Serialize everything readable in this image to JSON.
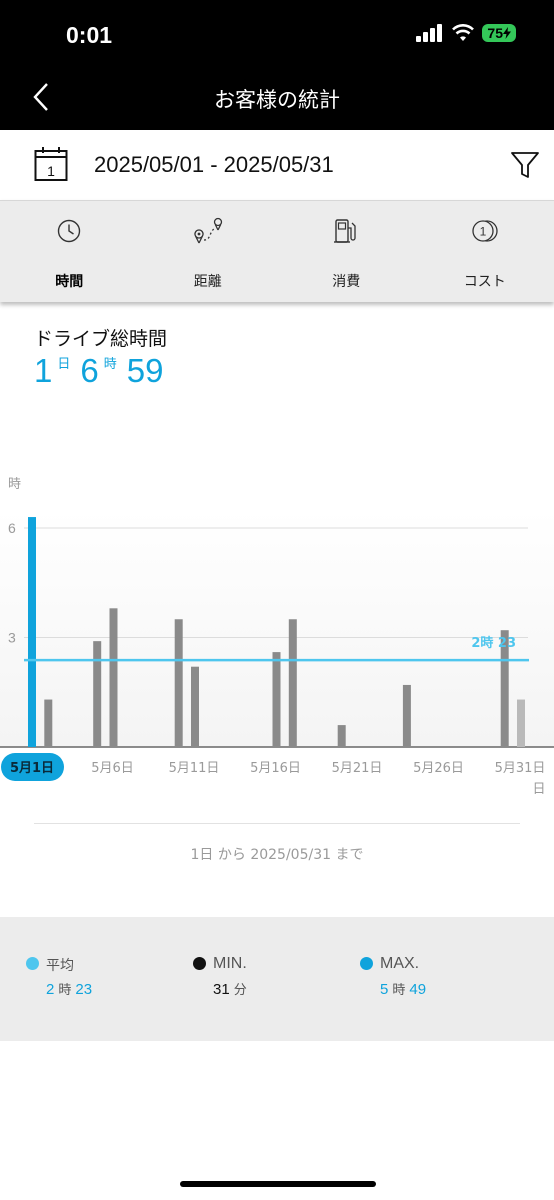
{
  "status_bar": {
    "time": "0:01",
    "battery": "75"
  },
  "header": {
    "title": "お客様の統計"
  },
  "date_filter": {
    "calendar_day": "1",
    "range": "2025/05/01 - 2025/05/31"
  },
  "tabs": [
    {
      "label": "時間",
      "icon": "clock-icon",
      "active": true
    },
    {
      "label": "距離",
      "icon": "route-icon",
      "active": false
    },
    {
      "label": "消費",
      "icon": "fuel-pump-icon",
      "active": false
    },
    {
      "label": "コスト",
      "icon": "coin-icon",
      "active": false
    }
  ],
  "summary": {
    "title": "ドライブ総時間",
    "days": "1",
    "days_unit": "日",
    "hours": "6",
    "hours_unit": "時",
    "minutes": "59"
  },
  "chart_data": {
    "type": "bar",
    "y_unit_label": "時",
    "x_unit_label": "日",
    "ylim": [
      0,
      8
    ],
    "yticks": [
      3,
      6
    ],
    "x": [
      1,
      2,
      3,
      4,
      5,
      6,
      7,
      8,
      9,
      10,
      11,
      12,
      13,
      14,
      15,
      16,
      17,
      18,
      19,
      20,
      21,
      22,
      23,
      24,
      25,
      26,
      27,
      28,
      29,
      30,
      31
    ],
    "values": [
      6.3,
      1.3,
      0,
      0,
      2.9,
      3.8,
      0,
      0,
      0,
      3.5,
      2.2,
      0,
      0,
      0,
      0,
      2.6,
      3.5,
      0,
      0,
      0.6,
      0,
      0,
      0,
      1.7,
      0,
      0,
      0,
      0,
      0,
      3.2,
      1.3
    ],
    "selected_index": 0,
    "pale_indices": [
      30
    ],
    "average": 2.38,
    "average_label": "2時 23",
    "tick_labels": [
      {
        "day": 1,
        "label": "5月1日"
      },
      {
        "day": 6,
        "label": "5月6日"
      },
      {
        "day": 11,
        "label": "5月11日"
      },
      {
        "day": 16,
        "label": "5月16日"
      },
      {
        "day": 21,
        "label": "5月21日"
      },
      {
        "day": 26,
        "label": "5月26日"
      },
      {
        "day": 31,
        "label": "5月31日"
      }
    ],
    "colors": {
      "selected": "#0fa3dc",
      "bar": "#8a8a8a",
      "pale": "#b9b9b9",
      "average_line": "#4ec6ee",
      "grid": "#dcdcdc"
    }
  },
  "range_text": {
    "from": "1日",
    "from_word": "から",
    "to": "2025/05/31",
    "to_word": "まで"
  },
  "stats": {
    "average": {
      "label": "平均",
      "hours": "2",
      "hours_unit": "時",
      "minutes": "23",
      "color": "#4ec6ee"
    },
    "min": {
      "label": "MIN.",
      "minutes": "31",
      "minutes_unit": "分",
      "color": "#111111"
    },
    "max": {
      "label": "MAX.",
      "hours": "5",
      "hours_unit": "時",
      "minutes": "49",
      "color": "#0fa3dc"
    }
  }
}
